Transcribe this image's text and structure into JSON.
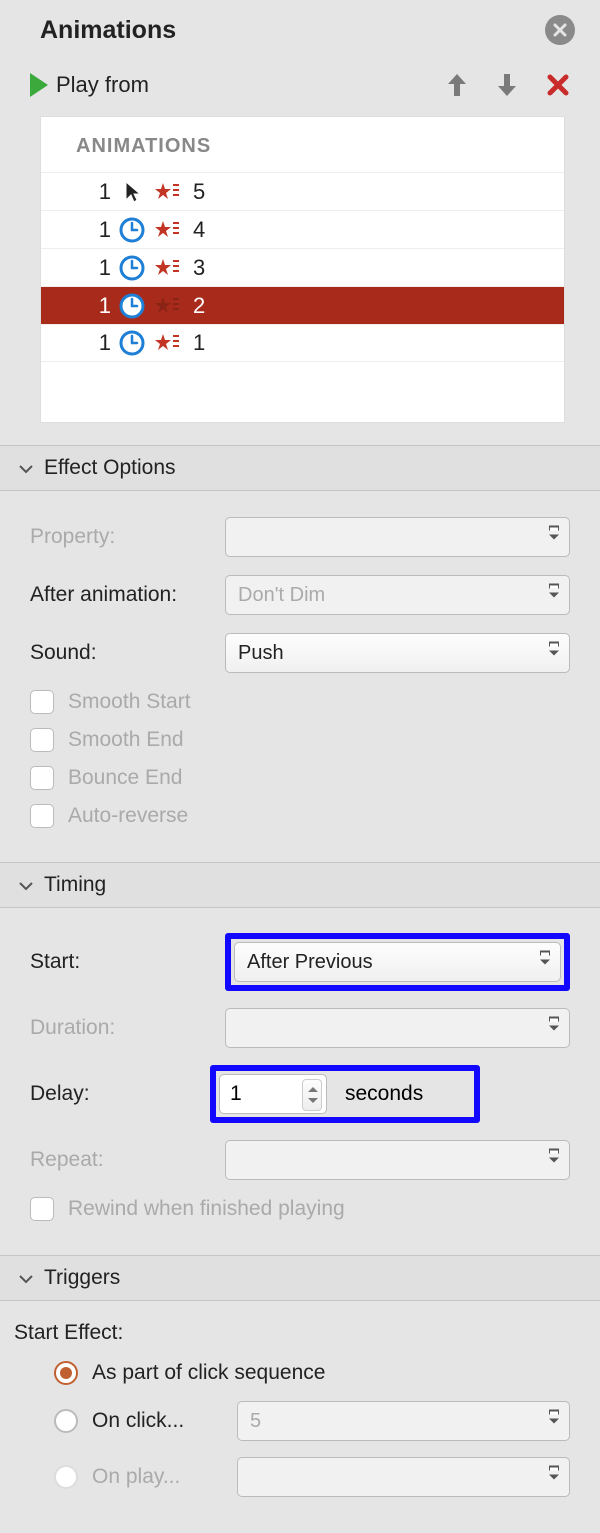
{
  "header": {
    "title": "Animations"
  },
  "toolbar": {
    "play_label": "Play from"
  },
  "list": {
    "header": "ANIMATIONS",
    "rows": [
      {
        "order": "1",
        "trigger": "click",
        "label": "5",
        "selected": false
      },
      {
        "order": "1",
        "trigger": "clock",
        "label": "4",
        "selected": false
      },
      {
        "order": "1",
        "trigger": "clock",
        "label": "3",
        "selected": false
      },
      {
        "order": "1",
        "trigger": "clock",
        "label": "2",
        "selected": true
      },
      {
        "order": "1",
        "trigger": "clock",
        "label": "1",
        "selected": false
      }
    ]
  },
  "effect_options": {
    "title": "Effect Options",
    "property_label": "Property:",
    "property_value": "",
    "after_anim_label": "After animation:",
    "after_anim_value": "Don't Dim",
    "sound_label": "Sound:",
    "sound_value": "Push",
    "smooth_start": "Smooth Start",
    "smooth_end": "Smooth End",
    "bounce_end": "Bounce End",
    "auto_reverse": "Auto-reverse"
  },
  "timing": {
    "title": "Timing",
    "start_label": "Start:",
    "start_value": "After Previous",
    "duration_label": "Duration:",
    "duration_value": "",
    "delay_label": "Delay:",
    "delay_value": "1",
    "delay_unit": "seconds",
    "repeat_label": "Repeat:",
    "repeat_value": "",
    "rewind_label": "Rewind when finished playing"
  },
  "triggers": {
    "title": "Triggers",
    "start_effect_label": "Start Effect:",
    "opt_click_seq": "As part of click sequence",
    "opt_on_click": "On click...",
    "on_click_value": "5",
    "opt_on_play": "On play..."
  }
}
